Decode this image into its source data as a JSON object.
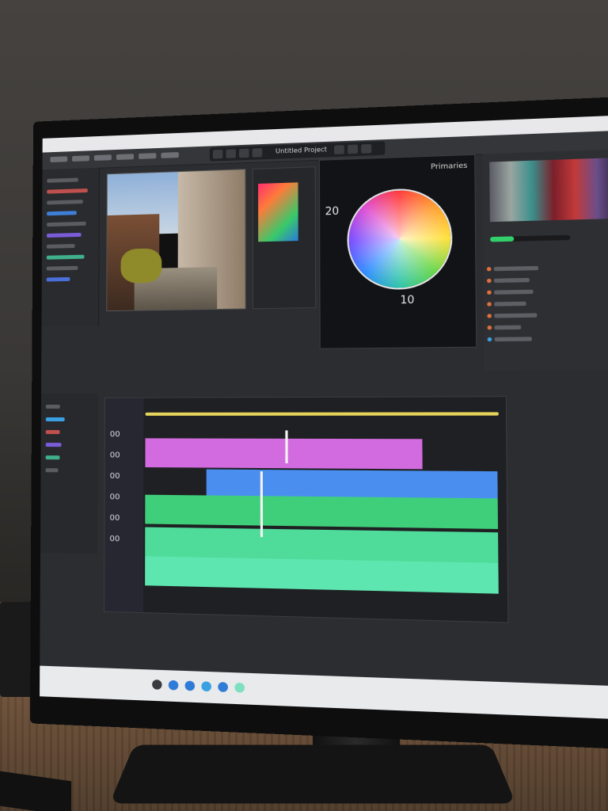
{
  "app": {
    "toolbar_title": "Untitled Project",
    "wheel_title": "Primaries",
    "wheel_number": "20",
    "wheel_bottom_number": "10"
  },
  "colors": {
    "accent_green": "#32d06a",
    "track_magenta": "#d36be0",
    "track_blue": "#4a8ff0",
    "track_green": "#3fcf7a",
    "ruler_yellow": "#e6d35a"
  },
  "timeline": {
    "track_labels": [
      "00",
      "00",
      "00",
      "00",
      "00",
      "00"
    ]
  }
}
